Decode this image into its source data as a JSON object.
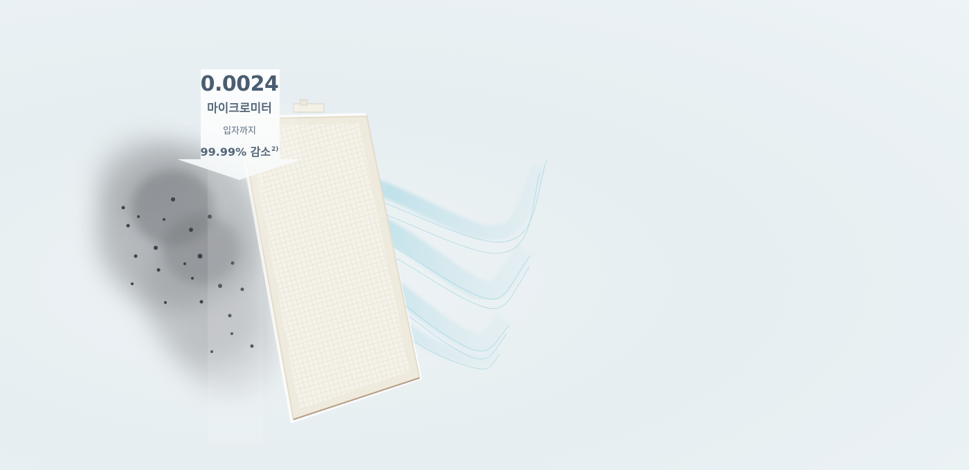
{
  "annotation": {
    "value": "0.0024",
    "unit": "마이크로미터",
    "particles_text": "입자까지",
    "reduction_text": "99.99% 감소",
    "footnote_mark": "2)"
  },
  "colors": {
    "text": "#4f6376",
    "airflow": "#6cc3d6",
    "filter_frame": "#efeade",
    "smoke": "#6b6e72"
  },
  "illustration": {
    "dust_icon": "dust-cloud-icon",
    "filter_icon": "hepa-filter-icon",
    "airflow_icon": "clean-airflow-icon"
  }
}
